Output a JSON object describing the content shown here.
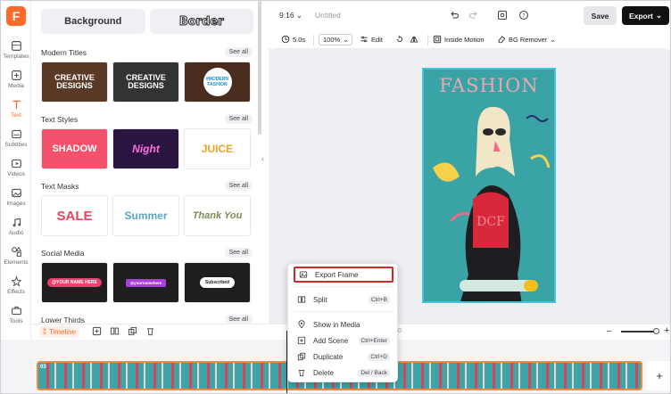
{
  "rail": {
    "items": [
      {
        "label": "Templates",
        "icon": "templates-icon"
      },
      {
        "label": "Media",
        "icon": "media-icon"
      },
      {
        "label": "Text",
        "icon": "text-icon"
      },
      {
        "label": "Subtitles",
        "icon": "subtitles-icon"
      },
      {
        "label": "Videos",
        "icon": "videos-icon"
      },
      {
        "label": "Images",
        "icon": "images-icon"
      },
      {
        "label": "Audio",
        "icon": "audio-icon"
      },
      {
        "label": "Elements",
        "icon": "elements-icon"
      },
      {
        "label": "Effects",
        "icon": "effects-icon"
      },
      {
        "label": "Tools",
        "icon": "tools-icon"
      }
    ],
    "active": "Text"
  },
  "panel": {
    "top_buttons": [
      "Background",
      "Border"
    ],
    "see_all": "See all",
    "sections": [
      {
        "title": "Modern Titles",
        "thumbs": [
          "CREATIVE DESIGNS",
          "CREATIVE DESIGNS",
          "#MODERN FASHION"
        ]
      },
      {
        "title": "Text Styles",
        "thumbs": [
          "SHADOW",
          "Night",
          "JUICE"
        ]
      },
      {
        "title": "Text Masks",
        "thumbs": [
          "SALE",
          "Summer",
          "Thank You"
        ]
      },
      {
        "title": "Social Media",
        "thumbs": [
          "@YOUR NAME HERE",
          "@yournamehere",
          "Subscribed"
        ]
      },
      {
        "title": "Lower Thirds",
        "thumbs": []
      }
    ]
  },
  "topbar": {
    "aspect_ratio": "9:16",
    "project_title": "Untitled",
    "save_label": "Save",
    "export_label": "Export"
  },
  "toolbar": {
    "duration": "5.0s",
    "zoom": "100%",
    "edit": "Edit",
    "inside_motion": "Inside Motion",
    "bg_remover": "BG Remover"
  },
  "canvas": {
    "headline": "FASHION"
  },
  "context_menu": {
    "items": [
      {
        "label": "Export Frame",
        "shortcut": "",
        "icon": "export-frame-icon",
        "highlighted": true
      },
      {
        "label": "Split",
        "shortcut": "Ctrl+B",
        "icon": "split-icon"
      },
      {
        "label": "Show in Media",
        "shortcut": "",
        "icon": "show-in-media-icon"
      },
      {
        "label": "Add Scene",
        "shortcut": "Ctrl+Enter",
        "icon": "add-scene-icon"
      },
      {
        "label": "Duplicate",
        "shortcut": "Ctrl+D",
        "icon": "duplicate-icon"
      },
      {
        "label": "Delete",
        "shortcut": "Del / Back",
        "icon": "delete-icon"
      }
    ]
  },
  "timeline": {
    "label": "Timeline",
    "time_marker": "0",
    "clip_label": "03",
    "add_label": "+"
  },
  "colors": {
    "accent": "#ff6a2b",
    "highlight_border": "#d2272a",
    "artboard_bg": "#3aa3a6",
    "clip_border": "#f08a3a"
  }
}
